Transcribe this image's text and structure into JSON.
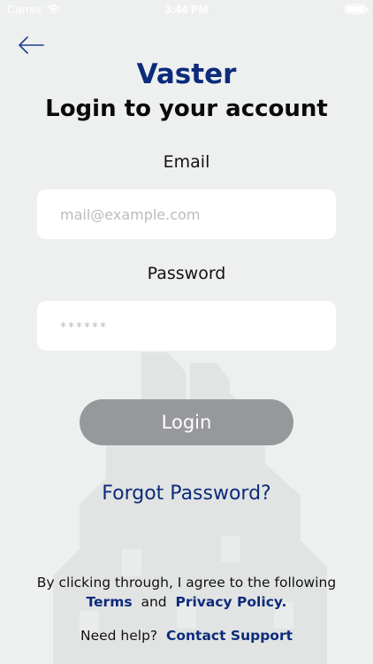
{
  "status_bar": {
    "carrier": "Carrier",
    "time": "3:44 PM"
  },
  "header": {
    "app_name": "Vaster",
    "title": "Login to your account"
  },
  "form": {
    "email_label": "Email",
    "email_placeholder": "mail@example.com",
    "password_label": "Password",
    "password_placeholder": "******",
    "login_label": "Login"
  },
  "links": {
    "forgot_password": "Forgot Password?"
  },
  "agreement": {
    "text": "By clicking through, I agree to the following",
    "terms": "Terms",
    "and": "and",
    "privacy": "Privacy Policy."
  },
  "help": {
    "text": "Need help?",
    "contact": "Contact Support"
  },
  "colors": {
    "brand": "#0c2b7a",
    "button": "#97989c",
    "background": "#eef0ef"
  }
}
